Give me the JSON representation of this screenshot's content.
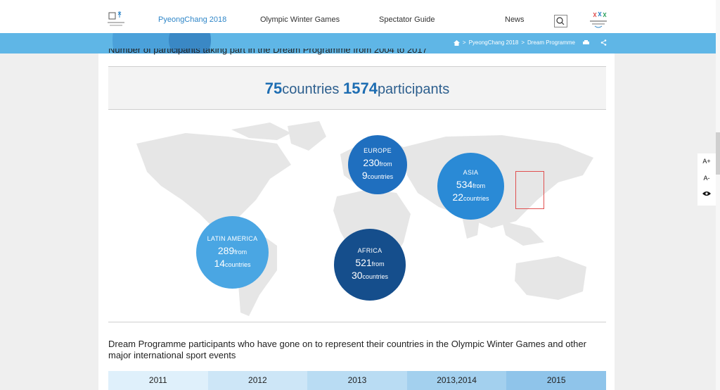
{
  "nav": {
    "brand": "PyeongChang 2018",
    "items": [
      "Olympic Winter Games",
      "Spectator Guide",
      "News"
    ]
  },
  "breadcrumb": {
    "items": [
      "PyeongChang 2018",
      "Dream Programme"
    ],
    "separator": ">"
  },
  "content": {
    "cut_heading": "Number of participants taking part in the Dream Programme from 2004 to 2017",
    "totals": {
      "countries_num": "75",
      "countries_label": "countries",
      "participants_num": "1574",
      "participants_label": "participants"
    },
    "regions": [
      {
        "name": "EUROPE",
        "participants": "230",
        "from_label": "from",
        "countries": "9",
        "countries_label": "countries",
        "color": "#1f6fbf"
      },
      {
        "name": "ASIA",
        "participants": "534",
        "from_label": "from",
        "countries": "22",
        "countries_label": "countries",
        "color": "#2a8ad6"
      },
      {
        "name": "LATIN AMERICA",
        "participants": "289",
        "from_label": "from",
        "countries": "14",
        "countries_label": "countries",
        "color": "#4aa6e3"
      },
      {
        "name": "AFRICA",
        "participants": "521",
        "from_label": "from",
        "countries": "30",
        "countries_label": "countries",
        "color": "#154e8c"
      }
    ],
    "section_text": "Dream Programme participants who have gone on to represent their countries in the Olympic Winter Games and other major international sport events",
    "years": [
      "2011",
      "2012",
      "2013",
      "2013,2014",
      "2015"
    ],
    "year_colors": [
      "#dff0fb",
      "#cde6f7",
      "#b9dcf3",
      "#a3d0ee",
      "#8fc4ea"
    ]
  },
  "tools": [
    "A+",
    "A-",
    "eye-icon"
  ],
  "colors": {
    "accent": "#5fb6e6",
    "brand": "#2f86c8"
  }
}
